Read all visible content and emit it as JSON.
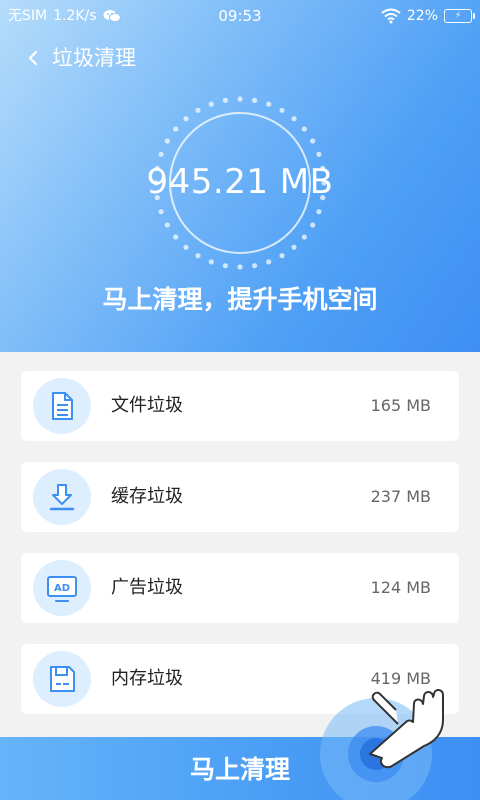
{
  "status_bar": {
    "carrier": "无SIM",
    "speed": "1.2K/s",
    "time": "09:53",
    "battery": "22%"
  },
  "header": {
    "title": "垃圾清理"
  },
  "scan": {
    "total_size": "945.21 MB",
    "slogan": "马上清理，提升手机空间"
  },
  "items": [
    {
      "label": "文件垃圾",
      "size": "165 MB",
      "icon": "document-icon"
    },
    {
      "label": "缓存垃圾",
      "size": "237 MB",
      "icon": "download-icon"
    },
    {
      "label": "广告垃圾",
      "size": "124 MB",
      "icon": "ad-monitor-icon"
    },
    {
      "label": "内存垃圾",
      "size": "419 MB",
      "icon": "floppy-disk-icon"
    }
  ],
  "action": {
    "clean_label": "马上清理"
  },
  "colors": {
    "accent": "#3f8ef4",
    "icon_bg": "#ddeefe",
    "icon_stroke": "#3d8ff3"
  }
}
